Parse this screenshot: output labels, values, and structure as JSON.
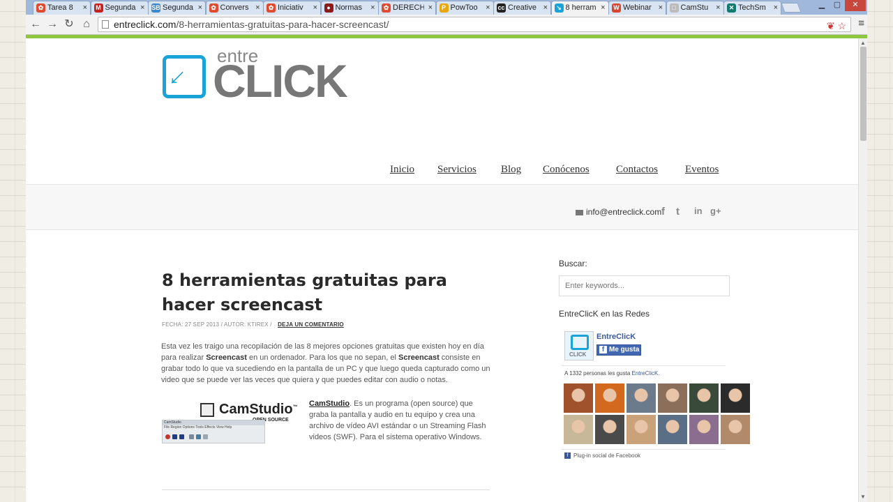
{
  "browser": {
    "tabs": [
      {
        "title": "Tarea 8",
        "favicon_color": "#e04a2f",
        "favicon_glyph": "✿"
      },
      {
        "title": "Segunda",
        "favicon_color": "#c5221f",
        "favicon_glyph": "M"
      },
      {
        "title": "Segunda",
        "favicon_color": "#3d88c9",
        "favicon_glyph": "SB"
      },
      {
        "title": "Convers",
        "favicon_color": "#e04a2f",
        "favicon_glyph": "✿"
      },
      {
        "title": "Iniciativ",
        "favicon_color": "#e04a2f",
        "favicon_glyph": "✿"
      },
      {
        "title": "Normas",
        "favicon_color": "#8b1a1a",
        "favicon_glyph": "●"
      },
      {
        "title": "DERECH",
        "favicon_color": "#e04a2f",
        "favicon_glyph": "✿"
      },
      {
        "title": "PowToo",
        "favicon_color": "#e8a70c",
        "favicon_glyph": "P"
      },
      {
        "title": "Creative",
        "favicon_color": "#222222",
        "favicon_glyph": "cc"
      },
      {
        "title": "8 herram",
        "favicon_color": "#1aa3d6",
        "favicon_glyph": "↘",
        "active": true
      },
      {
        "title": "Webinar",
        "favicon_color": "#d8452e",
        "favicon_glyph": "W"
      },
      {
        "title": "CamStu",
        "favicon_color": "#bbbbbb",
        "favicon_glyph": "□"
      },
      {
        "title": "TechSm",
        "favicon_color": "#117a6f",
        "favicon_glyph": "✕"
      }
    ],
    "tab_close_glyph": "×",
    "window_controls": {
      "minimize": "▁",
      "maximize": "▢",
      "close": "✕"
    },
    "nav": {
      "back": "←",
      "forward": "→",
      "reload": "↻",
      "home": "⌂",
      "menu": "≡"
    },
    "url_host": "entreclick.com",
    "url_path": "/8-herramientas-gratuitas-para-hacer-screencast/",
    "omnibox_icons": "❦ ☆"
  },
  "site": {
    "logo_small": "entre",
    "logo_big": "CLICK",
    "logo_arrow": "↓",
    "nav": [
      "Inicio",
      "Servicios",
      "Blog",
      "Conócenos",
      "Contactos",
      "Eventos"
    ],
    "email": "info@entreclick.com",
    "social_icons": [
      "f",
      "t",
      "in",
      "g+"
    ],
    "accent_color": "#8dc63f",
    "brand_color": "#1aa3d6"
  },
  "article": {
    "title": "8 herramientas gratuitas para hacer screencast",
    "meta": "FECHA: 27 SEP 2013 /   AUTOR: KTIREX /",
    "comment_link": "DEJA UN COMENTARIO",
    "intro_1": "Esta vez les traigo una  recopilación de las 8 mejores opciones gratuitas que existen hoy en día para realizar ",
    "intro_bold_1": "Screencast",
    "intro_2": " en un ordenador. Para los que no sepan,  el ",
    "intro_bold_2": "Screencast",
    "intro_3": " consiste en grabar todo lo que va sucediendo en la pantalla de un PC y que luego queda capturado  como un video que se puede ver las veces que quiera y que puedes editar con audio o notas.",
    "cam_image": {
      "brand": "CamStudio",
      "tm": "™",
      "sub": "OPEN SOURCE",
      "win_title": "CamStudio",
      "win_menu": "File   Region   Options   Tools   Effects   View   Help"
    },
    "cam_link": "CamStudio",
    "cam_desc": ". Es un programa (open source) que graba la pantalla y audio en tu equipo y crea una archivo de vídeo AVI estándar o un Streaming Flash videos (SWF). Para el sistema operativo Windows."
  },
  "sidebar": {
    "search_label": "Buscar:",
    "search_placeholder": "Enter keywords...",
    "social_heading": "EntreClicK en las Redes",
    "fb": {
      "page_name": "EntreClicK",
      "avatar_text": "CLICK",
      "like_label": "Me gusta",
      "fb_glyph": "f",
      "count_text": "A 1332 personas les gusta ",
      "count_page": "EntreClicK.",
      "plugin_label": "Plug-in social de Facebook",
      "face_colors": [
        "#a0522d",
        "#d2691e",
        "#6b7b8c",
        "#8b6f5a",
        "#3a4a3a",
        "#2b2b2b",
        "#c8b89a",
        "#4a4a4a",
        "#c9a27a",
        "#5a6e86",
        "#8a6d8f",
        "#b08a6a"
      ]
    }
  }
}
